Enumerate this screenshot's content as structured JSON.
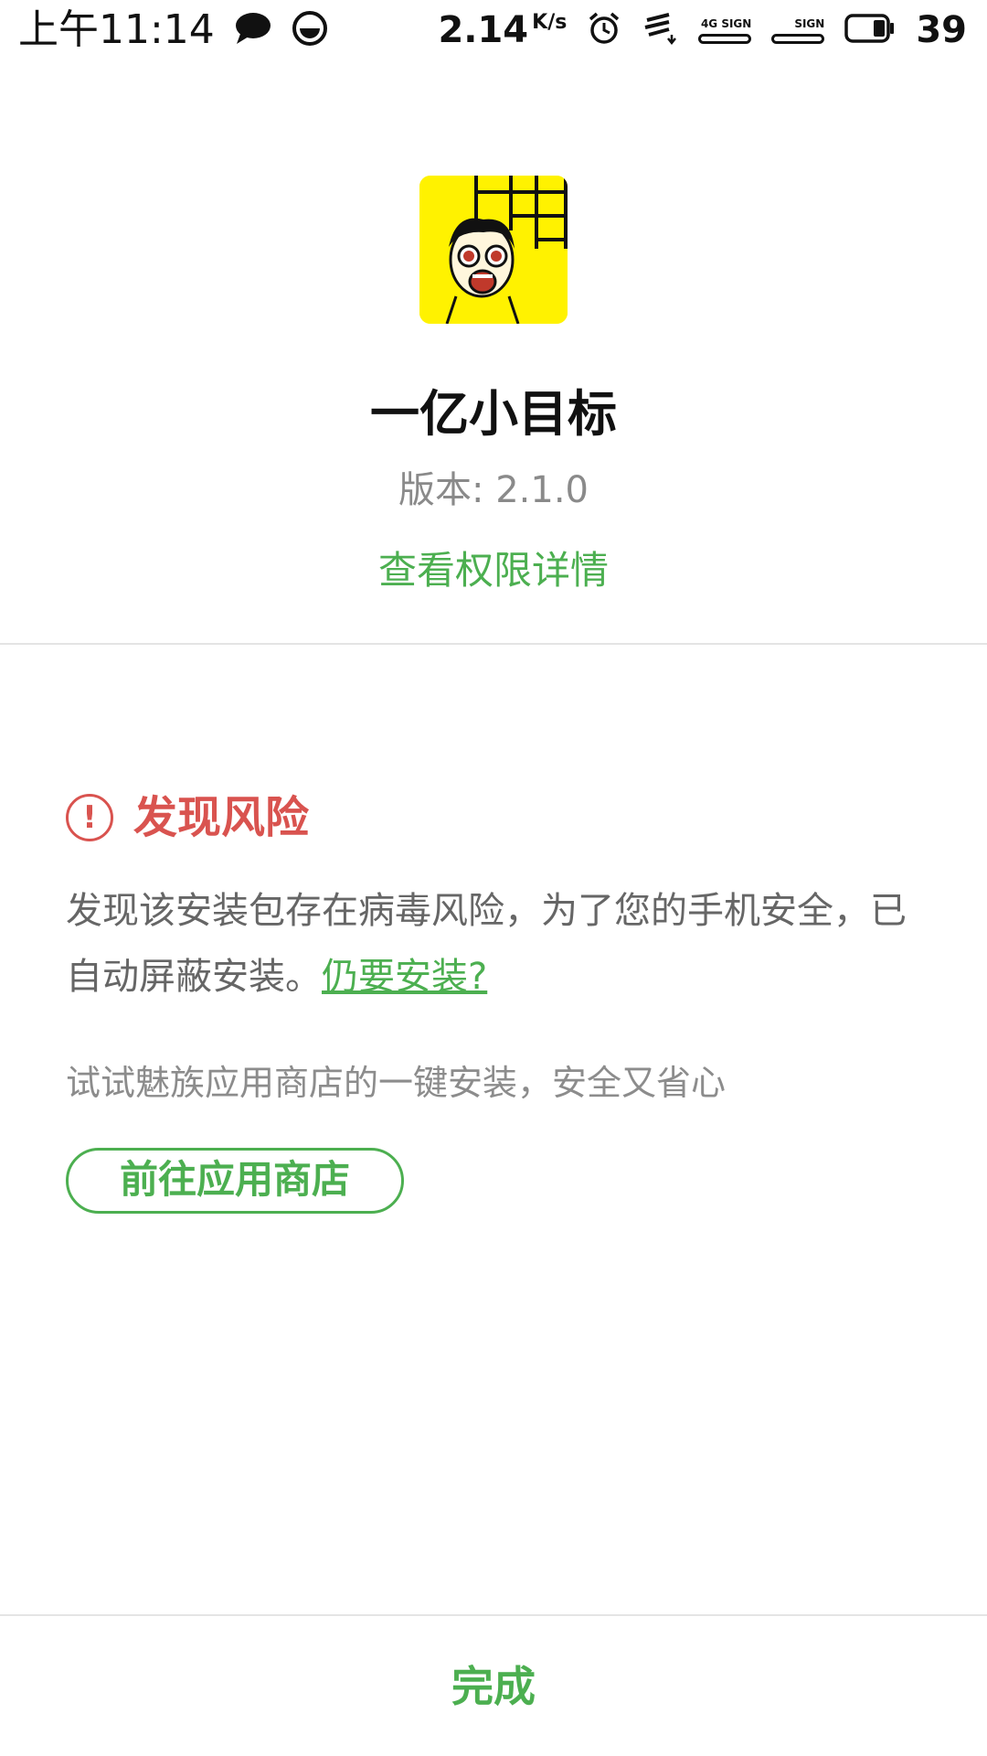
{
  "status_bar": {
    "time": "上午11:14",
    "net_speed": "2.14",
    "net_speed_unit": "K/s",
    "network_type": "4G",
    "sign_label_1": "SIGN",
    "sign_label_2": "SIGN",
    "battery_level": "39",
    "icons": [
      "chat-bubble-icon",
      "app-notification-icon",
      "alarm-clock-icon",
      "data-transfer-icon",
      "signal-icon",
      "signal-icon",
      "battery-icon"
    ]
  },
  "app": {
    "name": "一亿小目标",
    "version": "版本: 2.1.0",
    "permissions_link": "查看权限详情",
    "icon_colors": {
      "background": "#fff200"
    }
  },
  "risk": {
    "title": "发现风险",
    "description": "发现该安装包存在病毒风险，为了您的手机安全，已自动屏蔽安装。",
    "still_install_link": "仍要安装?",
    "store_hint": "试试魅族应用商店的一键安装，安全又省心",
    "store_button": "前往应用商店"
  },
  "footer": {
    "done_button": "完成"
  },
  "colors": {
    "accent_green": "#4caf50",
    "risk_red": "#d9534f",
    "secondary_text": "#8a8a8a"
  }
}
